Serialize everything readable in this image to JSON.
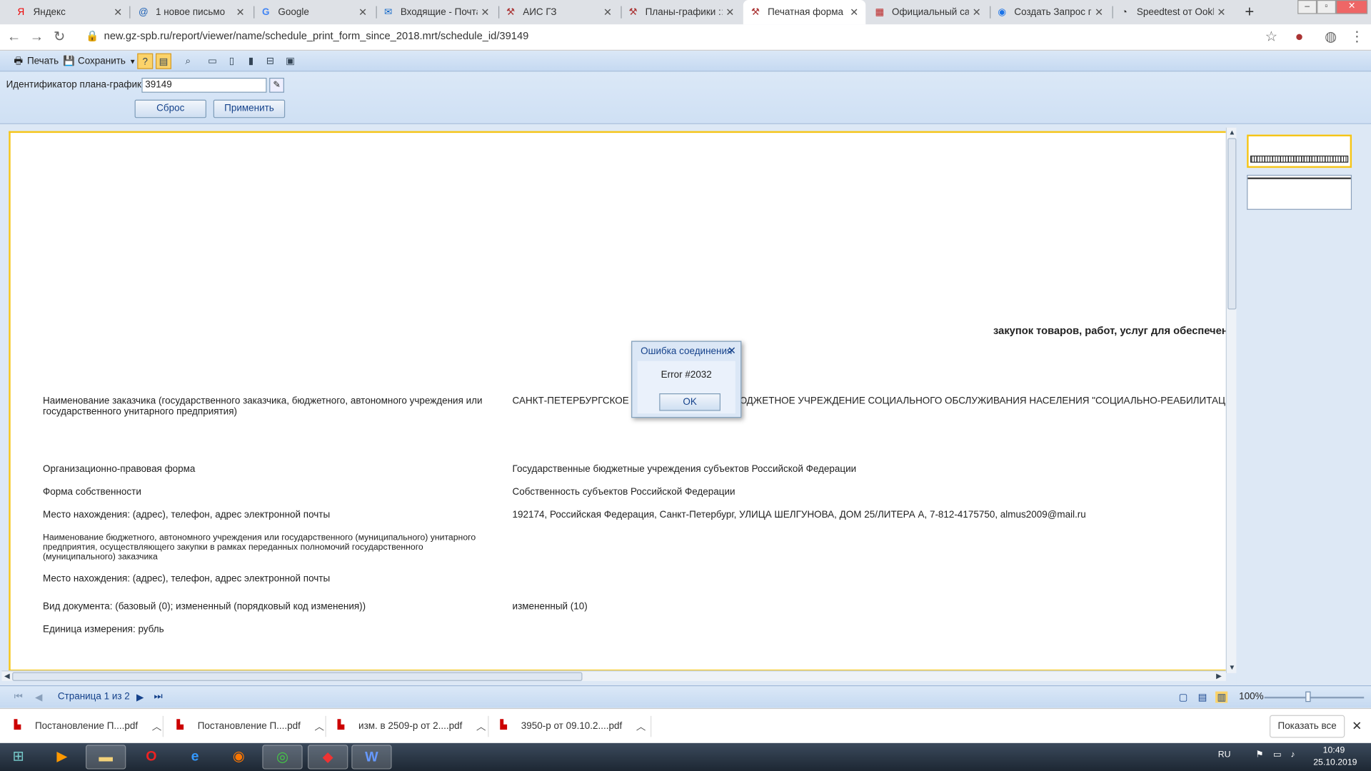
{
  "browser": {
    "tabs": [
      {
        "title": "Яндекс",
        "icon": "yandex-icon"
      },
      {
        "title": "1 новое письмо",
        "icon": "mail-icon"
      },
      {
        "title": "Google",
        "icon": "google-icon"
      },
      {
        "title": "Входящие - Почта I",
        "icon": "outlook-icon"
      },
      {
        "title": "АИС ГЗ",
        "icon": "hammer-icon"
      },
      {
        "title": "Планы-графики :: А",
        "icon": "hammer-icon"
      },
      {
        "title": "Печатная форма пл",
        "icon": "hammer-icon"
      },
      {
        "title": "Официальный сайт",
        "icon": "gov-icon"
      },
      {
        "title": "Создать Запрос по:",
        "icon": "globe-icon"
      },
      {
        "title": "Speedtest от Ookla",
        "icon": "speedtest-icon"
      }
    ],
    "url": "new.gz-spb.ru/report/viewer/name/schedule_print_form_since_2018.mrt/schedule_id/39149"
  },
  "toolbar": {
    "print_label": "Печать",
    "save_label": "Сохранить"
  },
  "params": {
    "label": "Идентификатор плана-графика",
    "value": "39149",
    "reset_label": "Сброс",
    "apply_label": "Применить"
  },
  "report": {
    "heading": "закупок товаров, работ, услуг для обеспечения г",
    "rows": [
      {
        "label": "Наименование заказчика (государственного заказчика, бюджетного, автономного учреждения или государственного унитарного предприятия)",
        "value": "САНКТ-ПЕТЕРБУРГСКОЕ ГОСУДАРСТВЕННОЕ БЮДЖЕТНОЕ УЧРЕЖДЕНИЕ СОЦИАЛЬНОГО ОБСЛУЖИВАНИЯ НАСЕЛЕНИЯ \"СОЦИАЛЬНО-РЕАБИЛИТАЦ"
      },
      {
        "label": "Организационно-правовая форма",
        "value": "Государственные бюджетные учреждения субъектов Российской Федерации"
      },
      {
        "label": "Форма собственности",
        "value": "Собственность субъектов Российской Федерации"
      },
      {
        "label": "Место нахождения:  (адрес), телефон, адрес электронной почты",
        "value": "192174, Российская Федерация, Санкт-Петербург, УЛИЦА ШЕЛГУНОВА, ДОМ 25/ЛИТЕРА А, 7-812-4175750, almus2009@mail.ru"
      },
      {
        "label": "Наименование бюджетного, автономного учреждения или государственного (муниципального) унитарного предприятия, осуществляющего закупки в рамках переданных полномочий государственного (муниципального) заказчика",
        "value": ""
      },
      {
        "label": "Место нахождения: (адрес), телефон, адрес электронной почты",
        "value": ""
      },
      {
        "label": "Вид документа: (базовый (0); измененный (порядковый код изменения))",
        "value": "измененный (10)"
      },
      {
        "label": "Единица измерения: рубль",
        "value": ""
      }
    ]
  },
  "dialog": {
    "title": "Ошибка соединения",
    "message": "Error #2032",
    "ok_label": "OK"
  },
  "pager": {
    "page_text": "Страница 1 из 2",
    "zoom": "100%"
  },
  "downloads": {
    "items": [
      "Постановление П....pdf",
      "Постановление П....pdf",
      "изм. в 2509-р от 2....pdf",
      "3950-р от 09.10.2....pdf"
    ],
    "show_all": "Показать все"
  },
  "taskbar": {
    "lang": "RU",
    "time": "10:49",
    "date": "25.10.2019"
  }
}
